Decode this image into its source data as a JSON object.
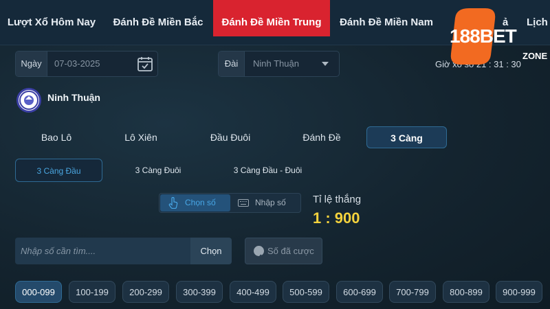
{
  "nav": {
    "tabs": [
      {
        "label": "Lượt Xổ Hôm Nay"
      },
      {
        "label": "Đánh Đề Miền Bắc"
      },
      {
        "label": "Đánh Đề Miền Trung"
      },
      {
        "label": "Đánh Đề Miền Nam"
      },
      {
        "label": "ả"
      },
      {
        "label": "Lịch"
      }
    ],
    "active_index": 2
  },
  "logo": {
    "brand": "188BET",
    "sub": "ZONE",
    "accent": "#f26a21"
  },
  "clock": {
    "label": "Giờ xổ số",
    "time": "21 : 31 : 30"
  },
  "filters": {
    "date_label": "Ngày",
    "date_value": "07-03-2025",
    "station_label": "Đài",
    "station_value": "Ninh Thuận"
  },
  "station": {
    "name": "Ninh Thuận"
  },
  "game_tabs": [
    {
      "label": "Bao Lô"
    },
    {
      "label": "Lô Xiên"
    },
    {
      "label": "Đầu Đuôi"
    },
    {
      "label": "Đánh Đề"
    },
    {
      "label": "3 Càng"
    }
  ],
  "sub_tabs": [
    {
      "label": "3 Càng Đầu"
    },
    {
      "label": "3 Càng Đuôi"
    },
    {
      "label": "3 Càng Đầu - Đuôi"
    }
  ],
  "mode": {
    "pick_label": "Chọn số",
    "input_label": "Nhập số"
  },
  "odds": {
    "label": "Tỉ lệ thắng",
    "value": "1 : 900"
  },
  "search": {
    "placeholder": "Nhập số cần tìm....",
    "button": "Chọn"
  },
  "bet_button": "Số đã cược",
  "ranges": [
    "000-099",
    "100-199",
    "200-299",
    "300-399",
    "400-499",
    "500-599",
    "600-699",
    "700-799",
    "800-899",
    "900-999"
  ],
  "colors": {
    "active_tab": "#d9232f",
    "odds": "#f4d23d",
    "accent_blue": "#48a7e6"
  }
}
